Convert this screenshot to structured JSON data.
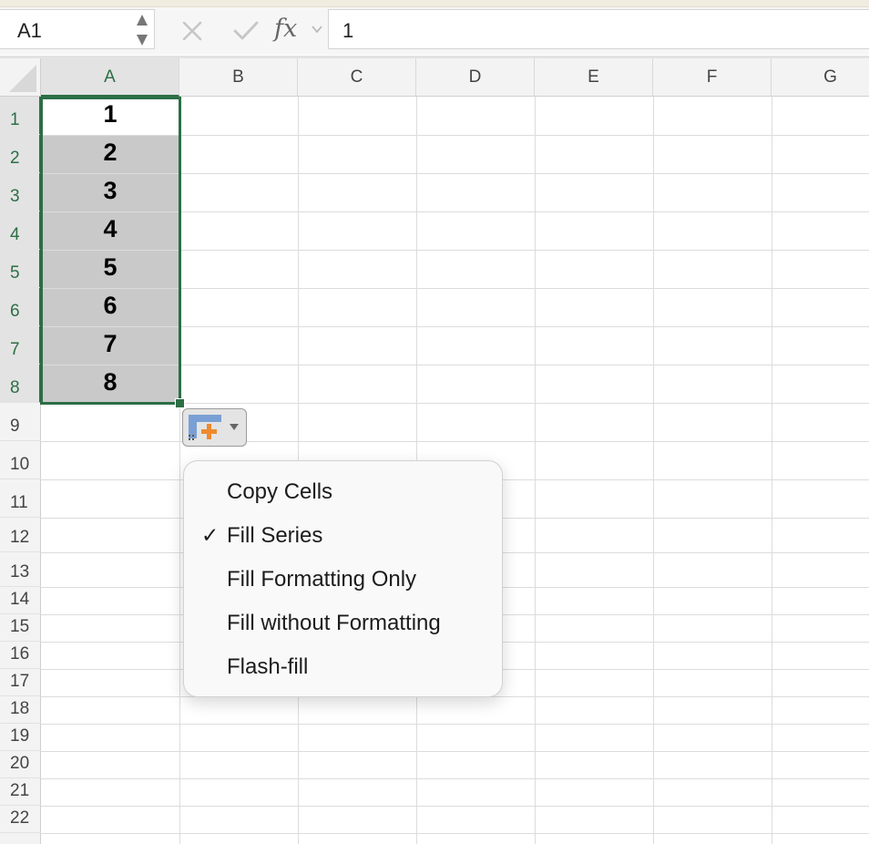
{
  "formula_bar": {
    "name_box": "A1",
    "cancel_icon": "close-icon",
    "enter_icon": "checkmark-icon",
    "fx_label": "fx",
    "value": "1"
  },
  "grid": {
    "columns": [
      "A",
      "B",
      "C",
      "D",
      "E",
      "F",
      "G"
    ],
    "rows": [
      "1",
      "2",
      "3",
      "4",
      "5",
      "6",
      "7",
      "8",
      "9",
      "10",
      "11",
      "12",
      "13",
      "14",
      "15",
      "16",
      "17",
      "18",
      "19",
      "20",
      "21",
      "22"
    ],
    "selected_column": "A",
    "selected_rows": [
      "1",
      "2",
      "3",
      "4",
      "5",
      "6",
      "7",
      "8"
    ],
    "cells_A": [
      "1",
      "2",
      "3",
      "4",
      "5",
      "6",
      "7",
      "8"
    ]
  },
  "colors": {
    "selection": "#2c6e45",
    "fill_highlight": "#c9c9c9",
    "autofill_icon_blue": "#7a9fd4",
    "autofill_icon_orange": "#ee8a2e"
  },
  "autofill_menu": {
    "icon": "paste-options-icon",
    "items": [
      {
        "label": "Copy Cells",
        "checked": false
      },
      {
        "label": "Fill Series",
        "checked": true
      },
      {
        "label": "Fill Formatting Only",
        "checked": false
      },
      {
        "label": "Fill without Formatting",
        "checked": false
      },
      {
        "label": "Flash-fill",
        "checked": false
      }
    ],
    "check_mark": "✓"
  }
}
